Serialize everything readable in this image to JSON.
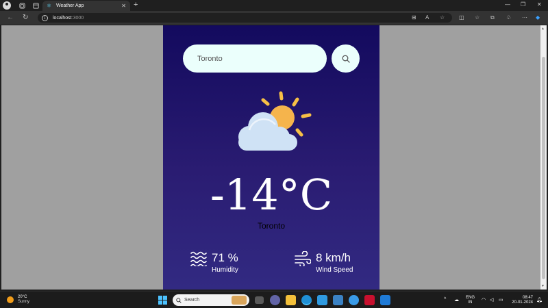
{
  "browser": {
    "tab_title": "Weather App",
    "tab_favicon": "react-icon",
    "url_host": "localhost",
    "url_port": ":3000"
  },
  "app": {
    "search": {
      "value": "Toronto",
      "placeholder": "Search"
    },
    "weather_icon": "partly-cloudy-icon",
    "temperature": "-14°C",
    "city": "Toronto",
    "humidity": {
      "value": "71 %",
      "label": "Humidity",
      "icon": "humidity-icon"
    },
    "wind": {
      "value": "8 km/h",
      "label": "Wind Speed",
      "icon": "wind-icon"
    }
  },
  "taskbar": {
    "weather_temp": "20°C",
    "weather_cond": "Sunny",
    "search_label": "Search",
    "lang_top": "ENG",
    "lang_bottom": "IN",
    "time": "08:47",
    "date": "20-01-2024"
  },
  "colors": {
    "card_top": "#130a5e",
    "card_bottom": "#322a82",
    "input_bg": "#ebfffc",
    "page_bg": "#a0a0a0"
  }
}
